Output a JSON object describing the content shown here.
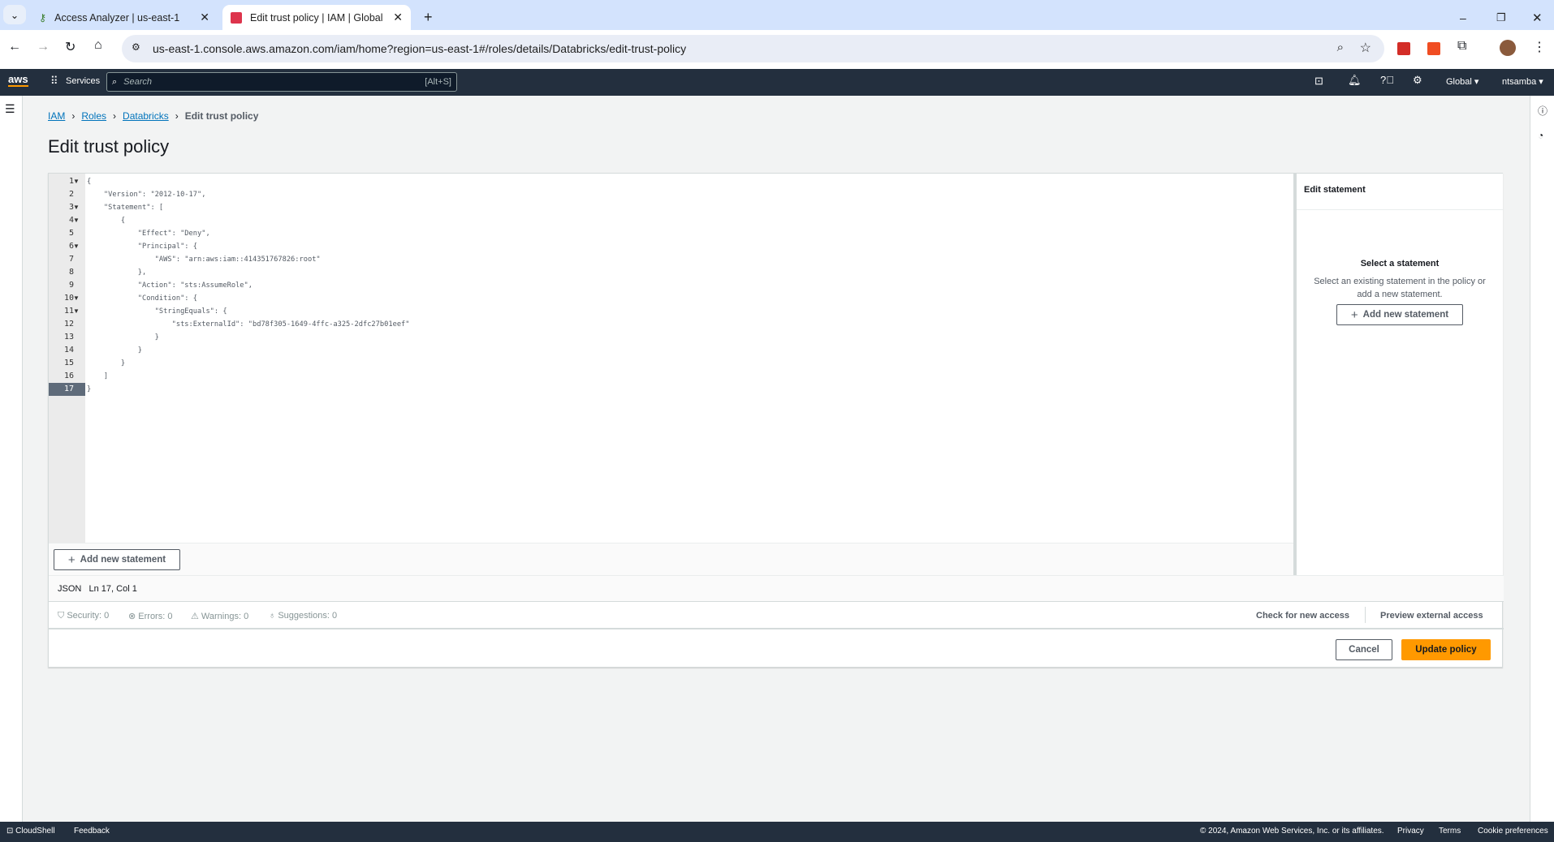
{
  "browser": {
    "tabs": [
      {
        "label": "Access Analyzer | us-east-1",
        "active": false
      },
      {
        "label": "Edit trust policy | IAM | Global",
        "active": true
      }
    ],
    "url": "us-east-1.console.aws.amazon.com/iam/home?region=us-east-1#/roles/details/Databricks/edit-trust-policy"
  },
  "awsnav": {
    "logo": "aws",
    "services": "Services",
    "search_placeholder": "Search",
    "search_shortcut": "[Alt+S]",
    "region": "Global ▾",
    "user": "ntsamba ▾"
  },
  "breadcrumbs": [
    "IAM",
    "Roles",
    "Databricks",
    "Edit trust policy"
  ],
  "page_title": "Edit trust policy",
  "editor": {
    "lines": [
      {
        "n": "1",
        "fold": true,
        "text": "{"
      },
      {
        "n": "2",
        "fold": false,
        "text": "    \"Version\": \"2012-10-17\","
      },
      {
        "n": "3",
        "fold": true,
        "text": "    \"Statement\": ["
      },
      {
        "n": "4",
        "fold": true,
        "text": "        {"
      },
      {
        "n": "5",
        "fold": false,
        "text": "            \"Effect\": \"Deny\","
      },
      {
        "n": "6",
        "fold": true,
        "text": "            \"Principal\": {"
      },
      {
        "n": "7",
        "fold": false,
        "text": "                \"AWS\": \"arn:aws:iam::414351767826:root\""
      },
      {
        "n": "8",
        "fold": false,
        "text": "            },"
      },
      {
        "n": "9",
        "fold": false,
        "text": "            \"Action\": \"sts:AssumeRole\","
      },
      {
        "n": "10",
        "fold": true,
        "text": "            \"Condition\": {"
      },
      {
        "n": "11",
        "fold": true,
        "text": "                \"StringEquals\": {"
      },
      {
        "n": "12",
        "fold": false,
        "text": "                    \"sts:ExternalId\": \"bd78f305-1649-4ffc-a325-2dfc27b01eef\""
      },
      {
        "n": "13",
        "fold": false,
        "text": "                }"
      },
      {
        "n": "14",
        "fold": false,
        "text": "            }"
      },
      {
        "n": "15",
        "fold": false,
        "text": "        }"
      },
      {
        "n": "16",
        "fold": false,
        "text": "    ]"
      },
      {
        "n": "17",
        "fold": false,
        "text": "}"
      }
    ],
    "current_line": "17",
    "add_statement": "Add new statement",
    "status_lang": "JSON",
    "status_pos": "Ln 17, Col 1"
  },
  "findings": {
    "security": "Security: 0",
    "errors": "Errors: 0",
    "warnings": "Warnings: 0",
    "suggestions": "Suggestions: 0",
    "check": "Check for new access",
    "preview": "Preview external access"
  },
  "panel": {
    "title": "Edit statement",
    "heading": "Select a statement",
    "desc": "Select an existing statement in the policy or add a new statement.",
    "add": "Add new statement"
  },
  "actions": {
    "cancel": "Cancel",
    "update": "Update policy"
  },
  "footer": {
    "cloudshell": "CloudShell",
    "feedback": "Feedback",
    "copyright": "© 2024, Amazon Web Services, Inc. or its affiliates.",
    "privacy": "Privacy",
    "terms": "Terms",
    "cookies": "Cookie preferences"
  },
  "colors": {
    "accent": "#ff9900",
    "nav": "#232f3e",
    "link": "#0073bb"
  }
}
